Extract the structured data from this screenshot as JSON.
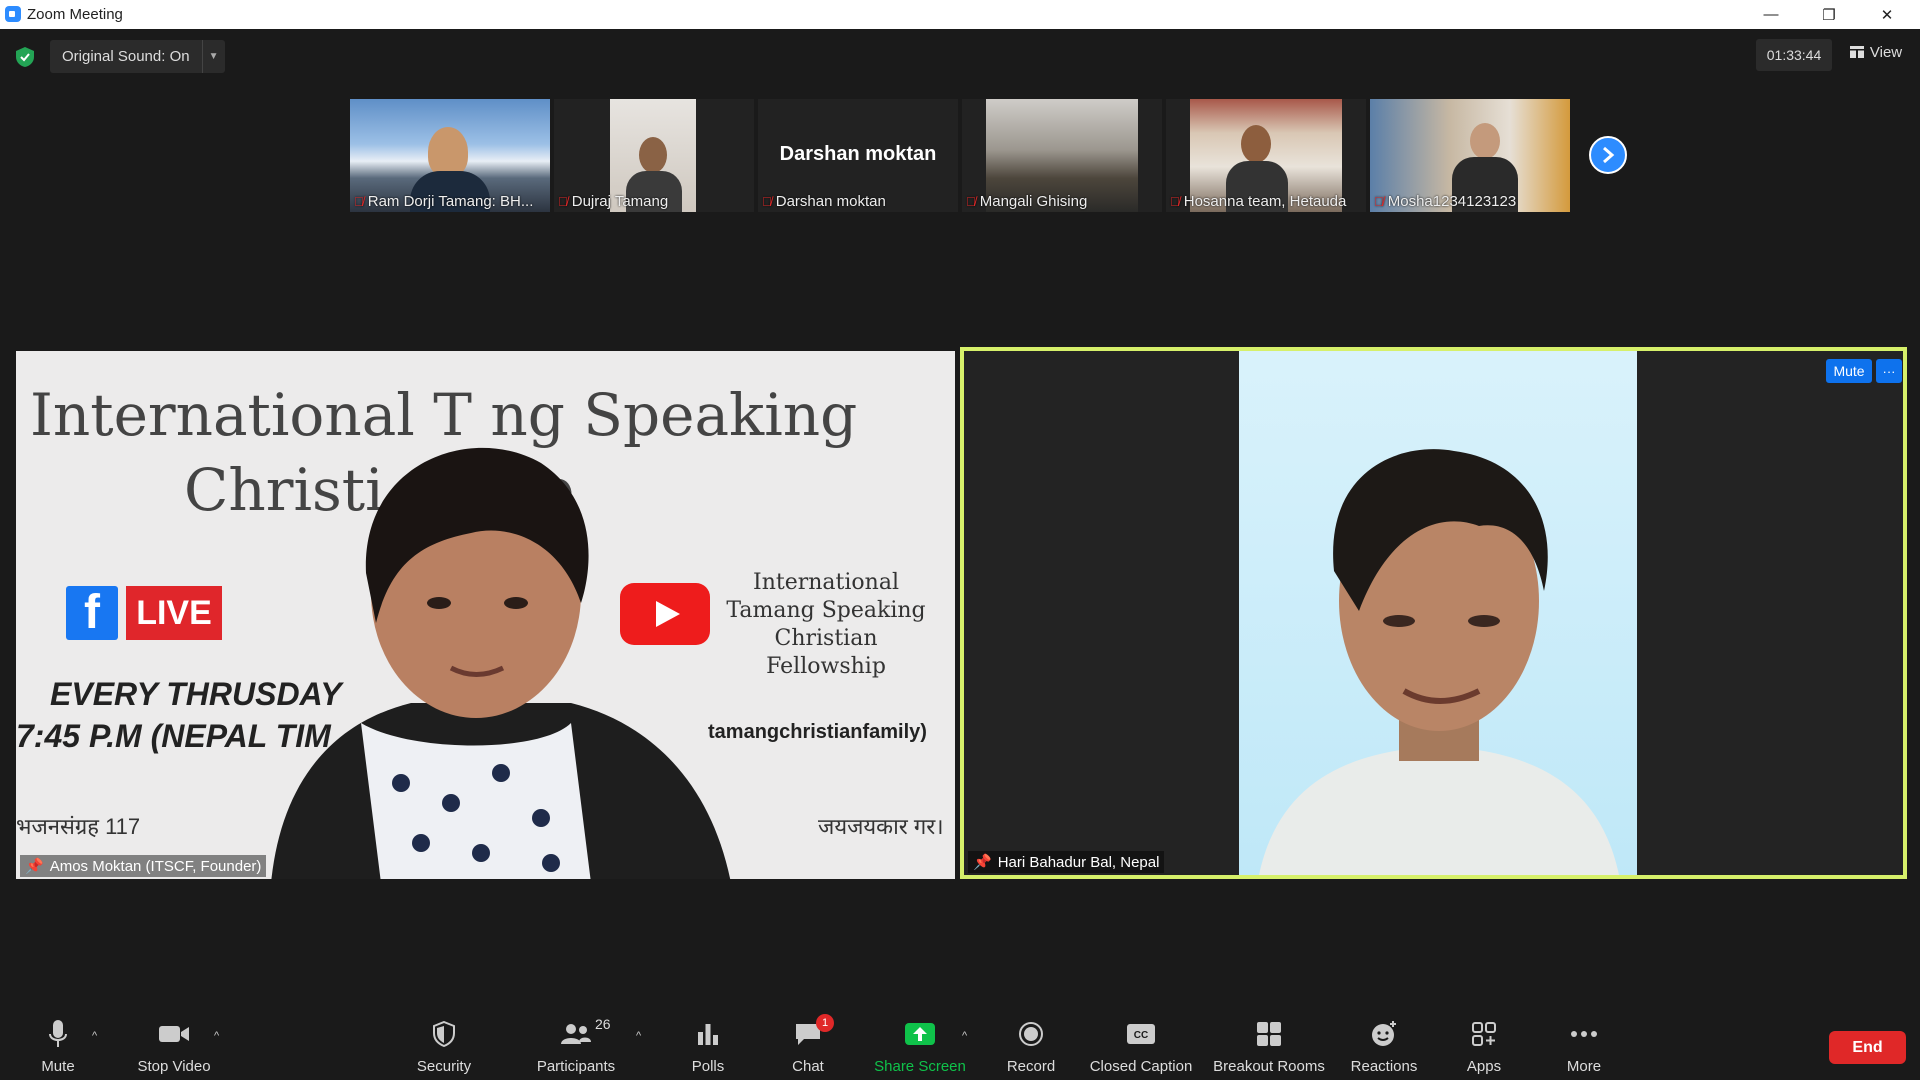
{
  "window": {
    "title": "Zoom Meeting",
    "minimize": "—",
    "restore": "❐",
    "close": "✕"
  },
  "topbar": {
    "original_sound": "Original Sound: On",
    "timer": "01:33:44",
    "view_label": "View"
  },
  "thumbnails": [
    {
      "name": "Ram Dorji Tamang: BH...",
      "type": "video"
    },
    {
      "name": "Dujraj Tamang",
      "type": "video"
    },
    {
      "name": "Darshan moktan",
      "type": "text",
      "display": "Darshan moktan"
    },
    {
      "name": "Mangali  Ghising",
      "type": "video"
    },
    {
      "name": "Hosanna team, Hetauda",
      "type": "video"
    },
    {
      "name": "Mosha1234123123",
      "type": "video"
    }
  ],
  "main": {
    "left": {
      "name": "Amos Moktan (ITSCF, Founder)",
      "background": {
        "line1": "International T      ng Speaking",
        "line2": "Christi           wship",
        "live": "LIVE",
        "itscf": "International Tamang Speaking Christian Fellowship",
        "every": "EVERY THRUSDAY",
        "time": "7:45 P.M (NEPAL TIM",
        "handle": "tamangchristianfamily)",
        "bhajan": "भजनसंग्रह 117",
        "jay": "जयजयकार गर।"
      }
    },
    "right": {
      "name": "Hari Bahadur Bal, Nepal",
      "mute_label": "Mute",
      "more_label": "···"
    }
  },
  "toolbar": {
    "mute": "Mute",
    "stop_video": "Stop Video",
    "security": "Security",
    "participants": "Participants",
    "participants_count": "26",
    "polls": "Polls",
    "chat": "Chat",
    "chat_badge": "1",
    "share_screen": "Share Screen",
    "record": "Record",
    "closed_caption": "Closed Caption",
    "breakout_rooms": "Breakout Rooms",
    "reactions": "Reactions",
    "apps": "Apps",
    "more": "More",
    "end": "End"
  },
  "colors": {
    "accent": "#2d8cff",
    "share": "#0fc24a",
    "end": "#e02828",
    "active_speaker": "#d6f06a"
  }
}
